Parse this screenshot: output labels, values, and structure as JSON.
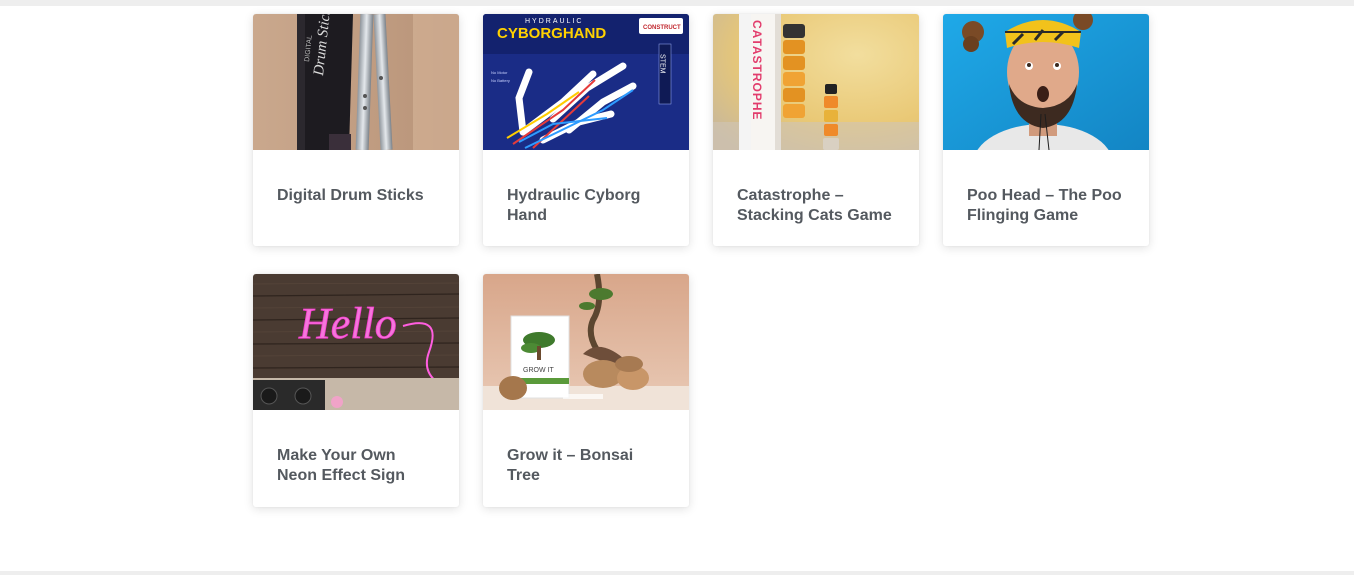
{
  "products": [
    {
      "title": "Digital Drum Sticks",
      "image_icon": "drum-sticks-product-image"
    },
    {
      "title": "Hydraulic Cyborg Hand",
      "image_icon": "cyborg-hand-product-image"
    },
    {
      "title": "Catastrophe – Stacking Cats Game",
      "image_icon": "stacking-cats-product-image"
    },
    {
      "title": "Poo Head – The Poo Flinging Game",
      "image_icon": "poo-head-product-image"
    },
    {
      "title": "Make Your Own Neon Effect Sign",
      "image_icon": "neon-sign-product-image"
    },
    {
      "title": "Grow it – Bonsai Tree",
      "image_icon": "bonsai-tree-product-image"
    }
  ],
  "image_text": {
    "drum_box_line1": "DIGITAL",
    "drum_box_line2": "Drum Sticks",
    "cyborg_brand": "HYDRAULIC",
    "cyborg_name": "CYBORGHAND",
    "cyborg_badge": "CONSTRUCT",
    "cyborg_stem": "STEM",
    "cats_box": "CATASTROPHE",
    "neon_word": "Hello",
    "bonsai_box": "GROW IT"
  }
}
